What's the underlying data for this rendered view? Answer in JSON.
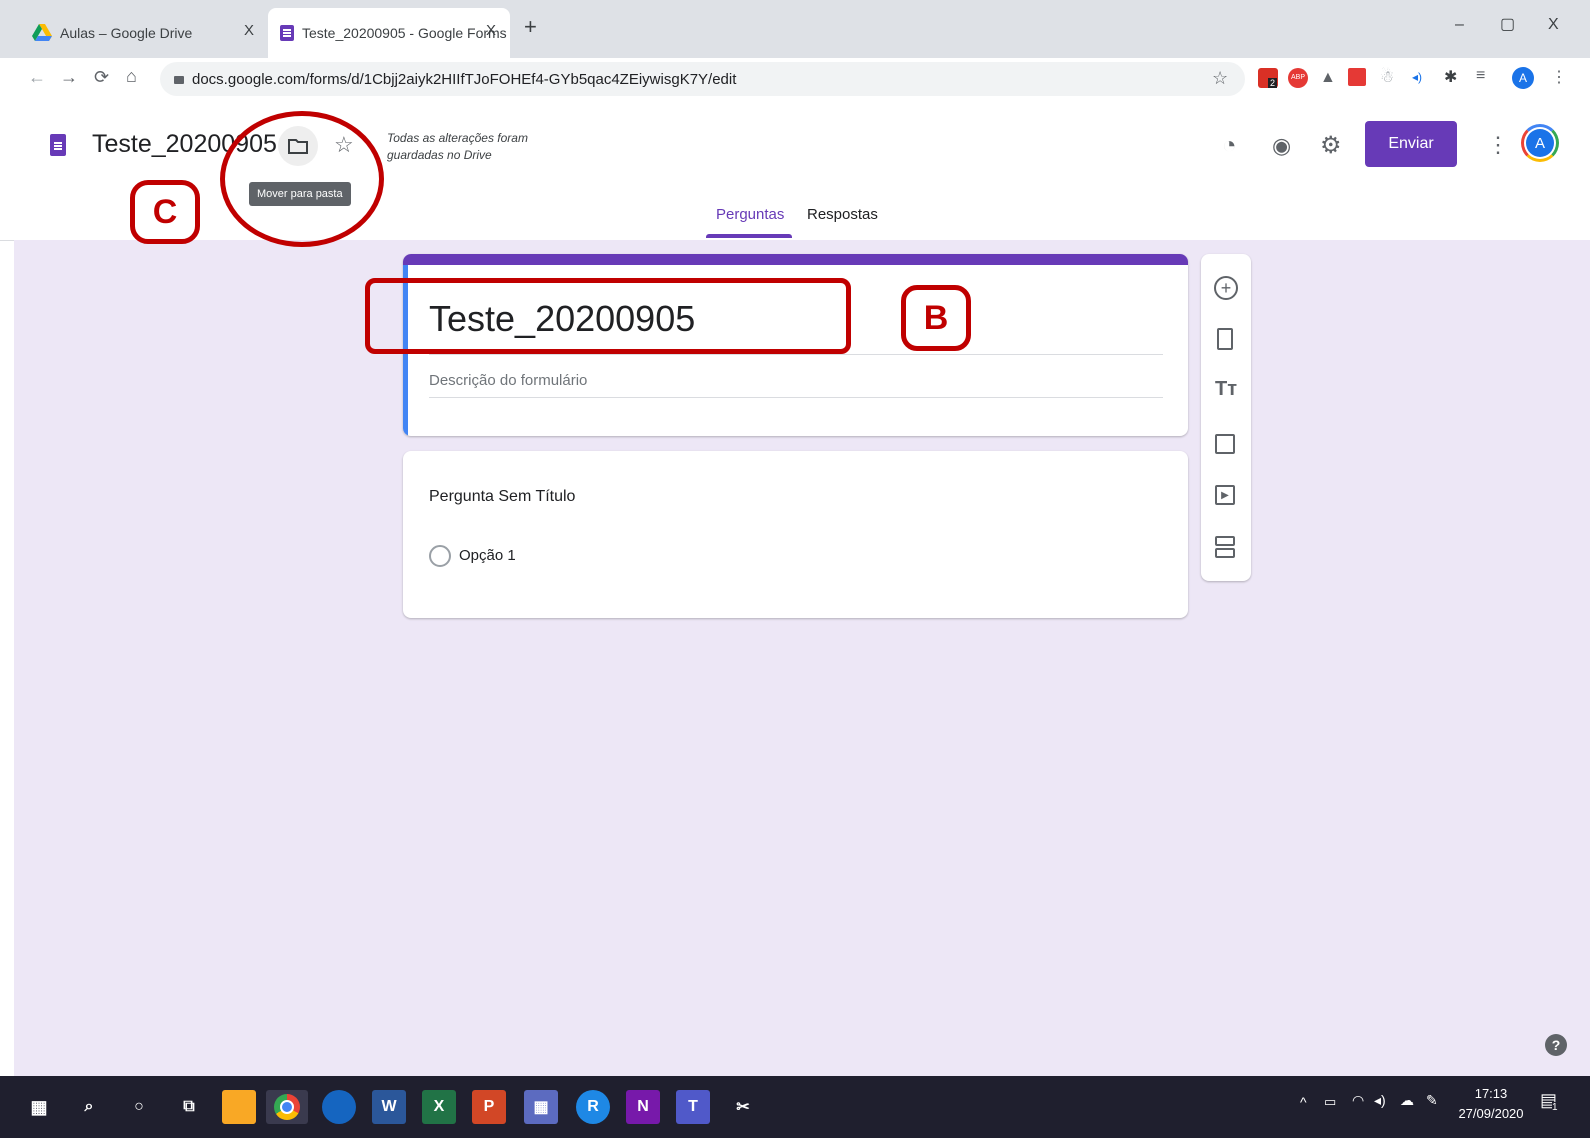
{
  "browser": {
    "tabs": [
      {
        "title": "Aulas – Google Drive",
        "close": "X"
      },
      {
        "title": "Teste_20200905 - Google Forms",
        "close": "X"
      }
    ],
    "new_tab": "+",
    "window_controls": {
      "minimize": "–",
      "restore": "▢",
      "close": "X"
    },
    "url": "docs.google.com/forms/d/1Cbjj2aiyk2HIIfTJoFOHEf4-GYb5qac4ZEiywisgK7Y/edit",
    "profile_initial": "A",
    "extension_badge": "2"
  },
  "header": {
    "doc_title": "Teste_20200905",
    "tooltip": "Mover para pasta",
    "save_status": "Todas as alterações foram guardadas no Drive",
    "send_label": "Enviar",
    "avatar_initial": "A",
    "tabs": [
      "Perguntas",
      "Respostas"
    ],
    "active_tab": "Perguntas"
  },
  "annotations": {
    "B": "B",
    "C": "C"
  },
  "form": {
    "title": "Teste_20200905",
    "description_placeholder": "Descrição do formulário",
    "question": {
      "title": "Pergunta Sem Título",
      "options": [
        "Opção 1"
      ]
    }
  },
  "taskbar": {
    "time": "17:13",
    "date": "27/09/2020",
    "notification_count": "1"
  },
  "colors": {
    "accent": "#673ab7",
    "canvas": "#ede7f6",
    "annotation_red": "#c00000",
    "focus_blue": "#4285f4"
  },
  "icons": {
    "help": "?"
  }
}
